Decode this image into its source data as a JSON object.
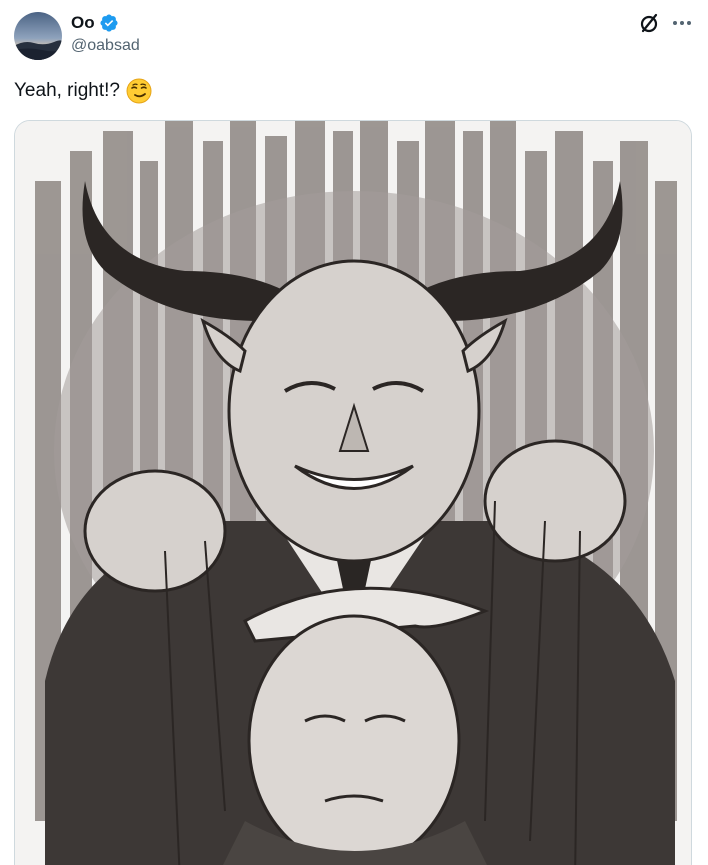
{
  "author": {
    "display_name": "Oo",
    "handle": "@oabsad",
    "verified": true,
    "avatar_icon": "avatar-sunset-icon"
  },
  "actions": {
    "grok_icon": "slashed-circle-icon",
    "more_icon": "more-dots-icon"
  },
  "tweet": {
    "text": "Yeah, right!?",
    "emoji": "smirking-face-emoji"
  },
  "media": {
    "alt_icon": "caricature-illustration",
    "colors": {
      "accent": "#1d9bf0",
      "border": "#cfd9de",
      "secondary_text": "#536471"
    }
  }
}
